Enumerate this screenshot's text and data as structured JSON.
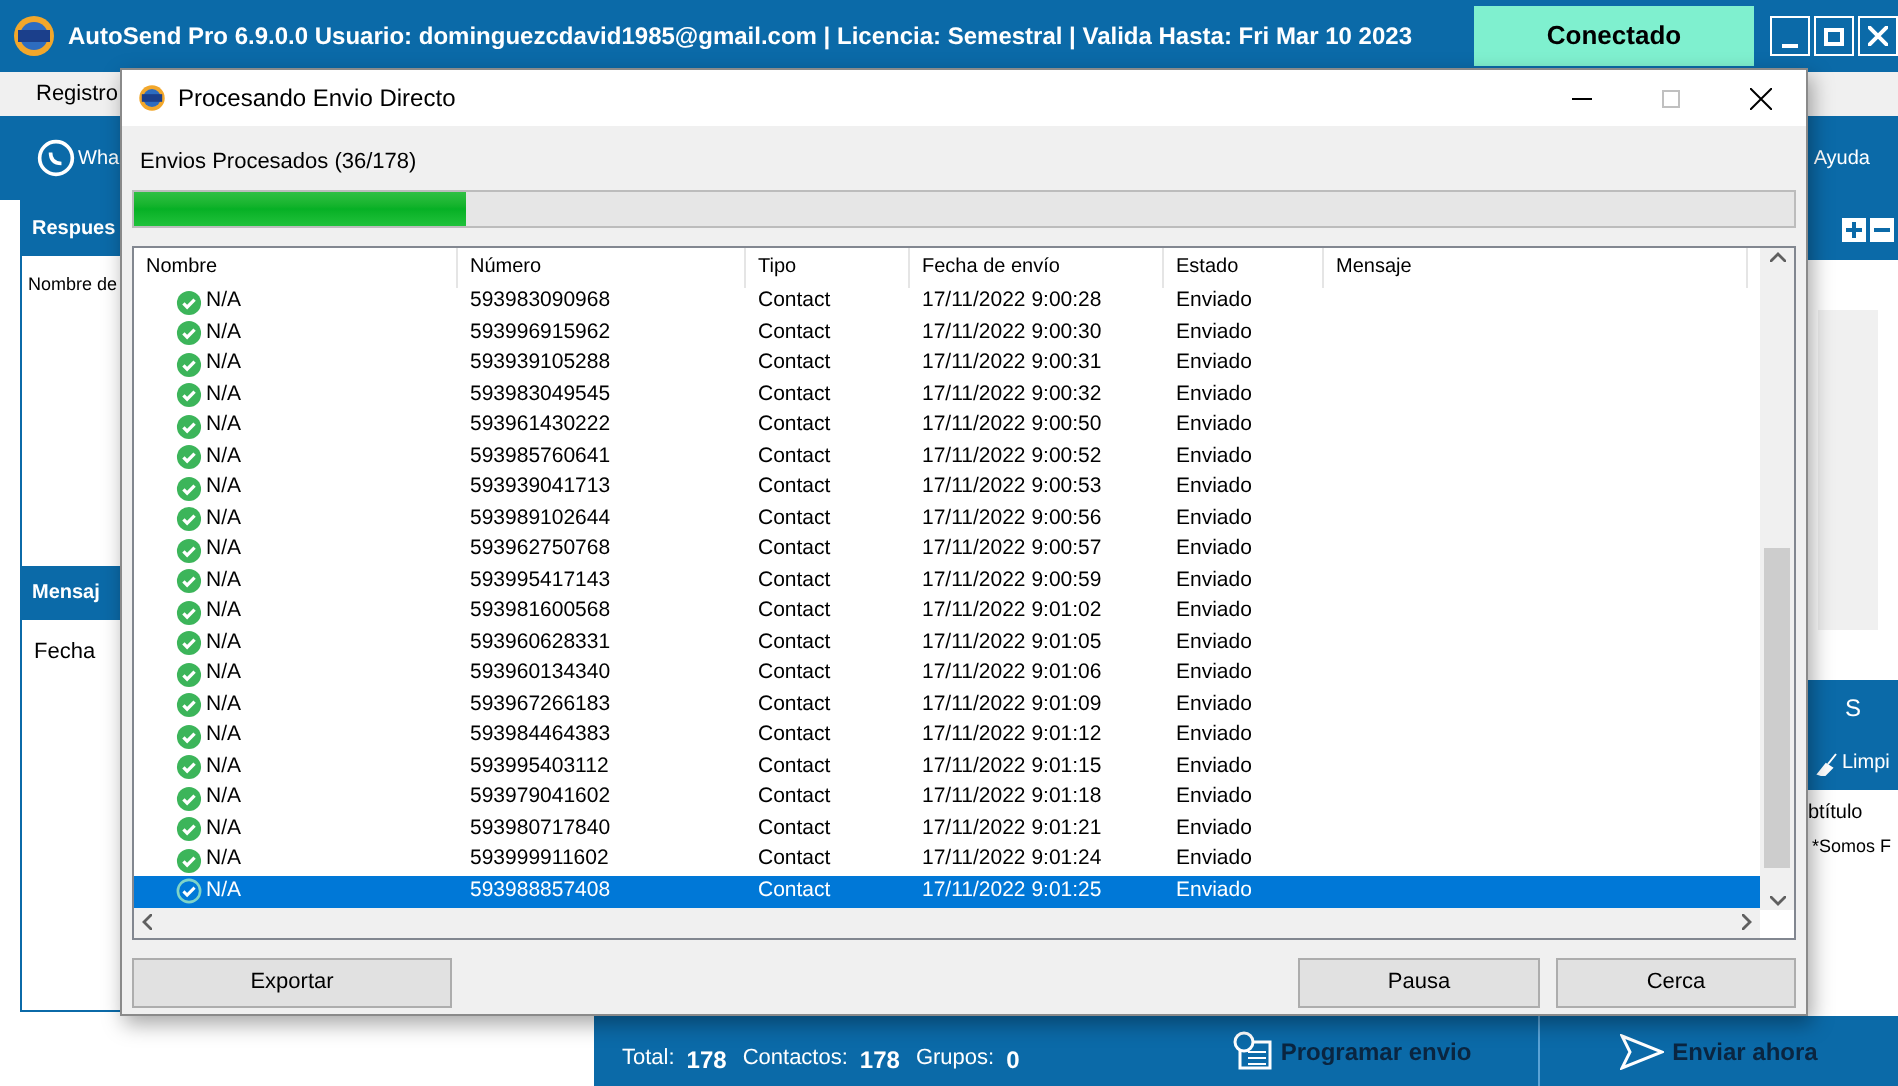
{
  "app": {
    "title": "AutoSend Pro 6.9.0.0  Usuario: dominguezcdavid1985@gmail.com | Licencia: Semestral | Valida Hasta: Fri Mar 10 2023",
    "status": "Conectado",
    "menu": [
      "Registro"
    ],
    "toolbar_left": "Wha",
    "toolbar_right": "Ayuda",
    "left_panel": {
      "header": "Respues",
      "label": "Nombre de",
      "header2": "Mensaj",
      "label2": "Fecha"
    },
    "right_panel": {
      "header": "S",
      "clear_button": "Limpi",
      "column": "btítulo",
      "cell": "*Somos F"
    },
    "summary": [
      {
        "label": "Total:",
        "value": "178"
      },
      {
        "label": "Contactos:",
        "value": "178"
      },
      {
        "label": "Grupos:",
        "value": "0"
      }
    ],
    "schedule_button": "Programar envio",
    "send_button": "Enviar ahora"
  },
  "dialog": {
    "title": "Procesando Envio Directo",
    "progress_label": "Envios Procesados (36/178)",
    "level": 0.2,
    "columns": [
      "Nombre",
      "Número",
      "Tipo",
      "Fecha de envío",
      "Estado",
      "Mensaje"
    ],
    "rows": [
      {
        "name": "N/A",
        "number": "593983090968",
        "type": "Contact",
        "date": "17/11/2022 9:00:28",
        "status": "Enviado",
        "selected": false
      },
      {
        "name": "N/A",
        "number": "593996915962",
        "type": "Contact",
        "date": "17/11/2022 9:00:30",
        "status": "Enviado",
        "selected": false
      },
      {
        "name": "N/A",
        "number": "593939105288",
        "type": "Contact",
        "date": "17/11/2022 9:00:31",
        "status": "Enviado",
        "selected": false
      },
      {
        "name": "N/A",
        "number": "593983049545",
        "type": "Contact",
        "date": "17/11/2022 9:00:32",
        "status": "Enviado",
        "selected": false
      },
      {
        "name": "N/A",
        "number": "593961430222",
        "type": "Contact",
        "date": "17/11/2022 9:00:50",
        "status": "Enviado",
        "selected": false
      },
      {
        "name": "N/A",
        "number": "593985760641",
        "type": "Contact",
        "date": "17/11/2022 9:00:52",
        "status": "Enviado",
        "selected": false
      },
      {
        "name": "N/A",
        "number": "593939041713",
        "type": "Contact",
        "date": "17/11/2022 9:00:53",
        "status": "Enviado",
        "selected": false
      },
      {
        "name": "N/A",
        "number": "593989102644",
        "type": "Contact",
        "date": "17/11/2022 9:00:56",
        "status": "Enviado",
        "selected": false
      },
      {
        "name": "N/A",
        "number": "593962750768",
        "type": "Contact",
        "date": "17/11/2022 9:00:57",
        "status": "Enviado",
        "selected": false
      },
      {
        "name": "N/A",
        "number": "593995417143",
        "type": "Contact",
        "date": "17/11/2022 9:00:59",
        "status": "Enviado",
        "selected": false
      },
      {
        "name": "N/A",
        "number": "593981600568",
        "type": "Contact",
        "date": "17/11/2022 9:01:02",
        "status": "Enviado",
        "selected": false
      },
      {
        "name": "N/A",
        "number": "593960628331",
        "type": "Contact",
        "date": "17/11/2022 9:01:05",
        "status": "Enviado",
        "selected": false
      },
      {
        "name": "N/A",
        "number": "593960134340",
        "type": "Contact",
        "date": "17/11/2022 9:01:06",
        "status": "Enviado",
        "selected": false
      },
      {
        "name": "N/A",
        "number": "593967266183",
        "type": "Contact",
        "date": "17/11/2022 9:01:09",
        "status": "Enviado",
        "selected": false
      },
      {
        "name": "N/A",
        "number": "593984464383",
        "type": "Contact",
        "date": "17/11/2022 9:01:12",
        "status": "Enviado",
        "selected": false
      },
      {
        "name": "N/A",
        "number": "593995403112",
        "type": "Contact",
        "date": "17/11/2022 9:01:15",
        "status": "Enviado",
        "selected": false
      },
      {
        "name": "N/A",
        "number": "593979041602",
        "type": "Contact",
        "date": "17/11/2022 9:01:18",
        "status": "Enviado",
        "selected": false
      },
      {
        "name": "N/A",
        "number": "593980717840",
        "type": "Contact",
        "date": "17/11/2022 9:01:21",
        "status": "Enviado",
        "selected": false
      },
      {
        "name": "N/A",
        "number": "593999911602",
        "type": "Contact",
        "date": "17/11/2022 9:01:24",
        "status": "Enviado",
        "selected": false
      },
      {
        "name": "N/A",
        "number": "593988857408",
        "type": "Contact",
        "date": "17/11/2022 9:01:25",
        "status": "Enviado",
        "selected": true
      }
    ],
    "buttons": [
      "Exportar",
      "Pausa",
      "Cerca"
    ]
  }
}
